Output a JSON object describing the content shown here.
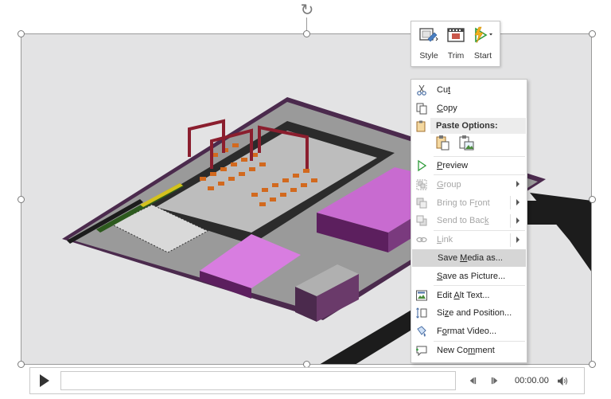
{
  "mini_toolbar": {
    "style_label": "Style",
    "trim_label": "Trim",
    "start_label": "Start"
  },
  "context_menu": {
    "items": [
      {
        "id": "cut",
        "pre": "Cu",
        "u": "t",
        "post": "",
        "icon": "scissors-icon",
        "enabled": true
      },
      {
        "id": "copy",
        "pre": "",
        "u": "C",
        "post": "opy",
        "icon": "copy-icon",
        "enabled": true
      },
      {
        "id": "preview",
        "pre": "",
        "u": "P",
        "post": "review",
        "icon": "play-outline-icon",
        "enabled": true
      },
      {
        "id": "group",
        "pre": "",
        "u": "G",
        "post": "roup",
        "icon": "group-icon",
        "enabled": false
      },
      {
        "id": "bring_to_front",
        "pre": "Bring to F",
        "u": "r",
        "post": "ont",
        "icon": "bring-front-icon",
        "enabled": false
      },
      {
        "id": "send_to_back",
        "pre": "Send to Bac",
        "u": "k",
        "post": "",
        "icon": "send-back-icon",
        "enabled": false
      },
      {
        "id": "link",
        "pre": "",
        "u": "L",
        "post": "ink",
        "icon": "link-icon",
        "enabled": false
      },
      {
        "id": "save_media",
        "pre": "Save ",
        "u": "M",
        "post": "edia as...",
        "icon": "",
        "enabled": true
      },
      {
        "id": "save_picture",
        "pre": "",
        "u": "S",
        "post": "ave as Picture...",
        "icon": "",
        "enabled": true
      },
      {
        "id": "edit_alt_text",
        "pre": "Edit ",
        "u": "A",
        "post": "lt Text...",
        "icon": "alt-text-icon",
        "enabled": true
      },
      {
        "id": "size_position",
        "pre": "Si",
        "u": "z",
        "post": "e and Position...",
        "icon": "size-position-icon",
        "enabled": true
      },
      {
        "id": "format_video",
        "pre": "F",
        "u": "o",
        "post": "rmat Video...",
        "icon": "format-video-icon",
        "enabled": true
      },
      {
        "id": "new_comment",
        "pre": "New Co",
        "u": "m",
        "post": "ment",
        "icon": "comment-icon",
        "enabled": true
      }
    ],
    "paste_options_label": "Paste Options:",
    "highlighted_item": "Save Media as..."
  },
  "media_controls": {
    "time": "00:00.00"
  },
  "colors": {
    "selection_handle": "#7a7a7a",
    "menu_highlight": "#d6d6d6",
    "disabled_text": "#a6a6a6",
    "building_magenta": "#b34dbf",
    "building_purple": "#5c1f5e",
    "crates_orange": "#d2691e"
  }
}
